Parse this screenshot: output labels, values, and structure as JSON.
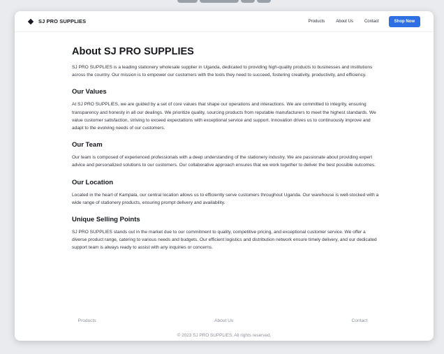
{
  "header": {
    "brand": "SJ PRO SUPPLIES",
    "nav": [
      "Products",
      "About Us",
      "Contact"
    ],
    "cta": "Shop Now"
  },
  "main": {
    "title": "About SJ PRO SUPPLIES",
    "intro": "SJ PRO SUPPLIES is a leading stationery wholesale supplier in Uganda, dedicated to providing high-quality products to businesses and institutions across the country. Our mission is to empower our customers with the tools they need to succeed, fostering creativity, productivity, and efficiency.",
    "sections": [
      {
        "heading": "Our Values",
        "body": "At SJ PRO SUPPLIES, we are guided by a set of core values that shape our operations and interactions. We are committed to integrity, ensuring transparency and honesty in all our dealings. We prioritize quality, sourcing products from reputable manufacturers to meet the highest standards. We value customer satisfaction, striving to exceed expectations with exceptional service and support. Innovation drives us to continuously improve and adapt to the evolving needs of our customers."
      },
      {
        "heading": "Our Team",
        "body": "Our team is composed of experienced professionals with a deep understanding of the stationery industry. We are passionate about providing expert advice and personalized solutions to our customers. Our collaborative approach ensures that we work together to deliver the best possible outcomes."
      },
      {
        "heading": "Our Location",
        "body": "Located in the heart of Kampala, our central location allows us to efficiently serve customers throughout Uganda. Our warehouse is well-stocked with a wide range of stationery products, ensuring prompt delivery and availability."
      },
      {
        "heading": "Unique Selling Points",
        "body": "SJ PRO SUPPLIES stands out in the market due to our commitment to quality, competitive pricing, and exceptional customer service. We offer a diverse product range, catering to various needs and budgets. Our efficient logistics and distribution network ensure timely delivery, and our dedicated support team is always ready to assist with any inquiries or concerns."
      }
    ]
  },
  "footer": {
    "links": [
      "Products",
      "About Us",
      "Contact"
    ],
    "copyright": "© 2023 SJ PRO SUPPLIES. All rights reserved."
  },
  "colors": {
    "accent": "#2f6fe4",
    "text": "#16181d",
    "muted": "#8a9099"
  },
  "icons": {
    "brand_logo": "diamond-logo-icon"
  }
}
